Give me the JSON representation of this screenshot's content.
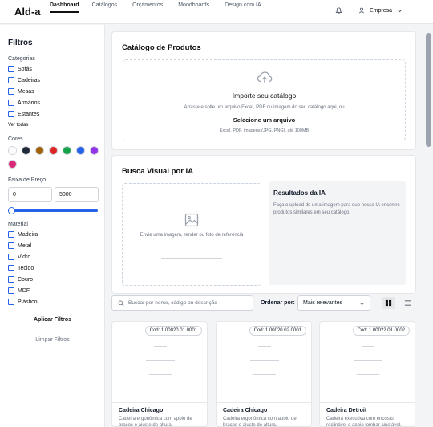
{
  "brand": "Ald-a",
  "nav": [
    "Dashboard",
    "Catálogos",
    "Orçamentos",
    "Moodboards",
    "Design com IA"
  ],
  "user": {
    "name": "Empresa"
  },
  "filters": {
    "title": "Filtros",
    "categories_label": "Categorias",
    "categories": [
      "Sofás",
      "Cadeiras",
      "Mesas",
      "Armários",
      "Estantes"
    ],
    "see_all": "Ver todas",
    "colors_label": "Cores",
    "colors": [
      "#ffffff",
      "#1f2937",
      "#a16207",
      "#dc2626",
      "#16a34a",
      "#2563eb",
      "#9333ea",
      "#db2777"
    ],
    "price_label": "Faixa de Preço",
    "price_min": "0",
    "price_max": "5000",
    "material_label": "Material",
    "materials": [
      "Madeira",
      "Metal",
      "Vidro",
      "Tecido",
      "Couro",
      "MDF",
      "Plástico"
    ],
    "apply": "Aplicar Filtros",
    "clear": "Limpar Filtros"
  },
  "catalog": {
    "title": "Catálogo de Produtos",
    "import_title": "Importe seu catálogo",
    "import_desc": "Arraste e solte um arquivo Excel, PDF ou imagem do seu catálogo aqui, ou",
    "select_file": "Selecione um arquivo",
    "formats": "Excel, PDF, imagens (JPG, PNG), até 100MB"
  },
  "visual_search": {
    "title": "Busca Visual por IA",
    "drop_text": "Envie uma imagem, render ou foto de referência",
    "results_title": "Resultados da IA",
    "results_desc": "Faça o upload de uma imagem para que nossa IA encontre produtos similares em seu catálogo."
  },
  "toolbar": {
    "search_placeholder": "Buscar por nome, código ou descrição",
    "sort_label": "Ordenar por:",
    "sort_value": "Mais relevantes"
  },
  "products": [
    {
      "code": "Cod: 1.00020.01.0001",
      "name": "Cadeira Chicago",
      "desc": "Cadeira ergonômica com apoio de braços e ajuste de altura."
    },
    {
      "code": "Cod: 1.00020.02.0001",
      "name": "Cadeira Chicago",
      "desc": "Cadeira ergonômica com apoio de braços e ajuste de altura."
    },
    {
      "code": "Cod: 1.00022.01.0002",
      "name": "Cadeira Detroit",
      "desc": "Cadeira executiva com encosto reclinável e apoio lombar ajustável."
    }
  ]
}
